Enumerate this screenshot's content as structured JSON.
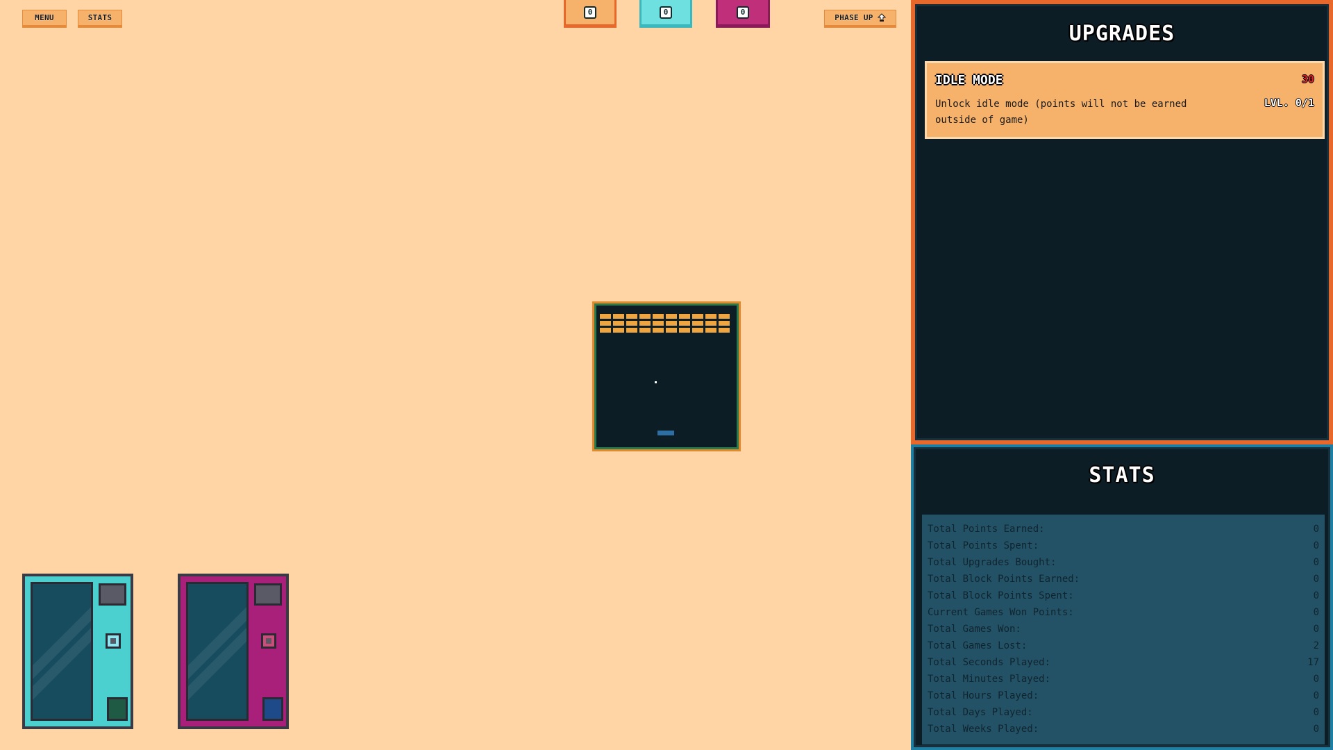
{
  "top_bar": {
    "menu_label": "MENU",
    "stats_label": "STATS",
    "phase_up_label": "PHASE UP",
    "counters": [
      {
        "name": "orange",
        "value": "0",
        "color": "#f6b26b",
        "border": "#e8672a"
      },
      {
        "name": "cyan",
        "value": "0",
        "color": "#6fe0e0",
        "border": "#3ab8c0"
      },
      {
        "name": "magenta",
        "value": "0",
        "color": "#c0307a",
        "border": "#8a1a5a"
      }
    ]
  },
  "upgrades": {
    "title": "UPGRADES",
    "items": [
      {
        "name": "IDLE MODE",
        "cost": "30",
        "description": "Unlock idle mode (points will not be earned outside of game)",
        "level": "LVL. 0/1"
      }
    ]
  },
  "stats": {
    "title": "STATS",
    "rows": [
      {
        "label": "Total Points Earned:",
        "value": "0"
      },
      {
        "label": "Total Points Spent:",
        "value": "0"
      },
      {
        "label": "Total Upgrades Bought:",
        "value": "0"
      },
      {
        "label": "Total Block Points Earned:",
        "value": "0"
      },
      {
        "label": "Total Block Points Spent:",
        "value": "0"
      },
      {
        "label": "Current Games Won Points:",
        "value": "0"
      },
      {
        "label": "Total Games Won:",
        "value": "0"
      },
      {
        "label": "Total Games Lost:",
        "value": "2"
      },
      {
        "label": "Total Seconds Played:",
        "value": "17"
      },
      {
        "label": "Total Minutes Played:",
        "value": "0"
      },
      {
        "label": "Total Hours Played:",
        "value": "0"
      },
      {
        "label": "Total Days Played:",
        "value": "0"
      },
      {
        "label": "Total Weeks Played:",
        "value": "0"
      }
    ]
  },
  "machines": [
    {
      "name": "cyan-machine",
      "color": "#4ccfcf",
      "slot_accent": "#8ce8f0",
      "tray_color": "#1f5a44"
    },
    {
      "name": "magenta-machine",
      "color": "#a8207a",
      "slot_accent": "#d04a7a",
      "tray_color": "#1e4a8a"
    }
  ],
  "breakout": {
    "brick_rows": 3,
    "brick_cols": 10,
    "brick_color": "#f0a640"
  },
  "icons": {
    "phase_up": "phase-up-arrow-icon"
  }
}
